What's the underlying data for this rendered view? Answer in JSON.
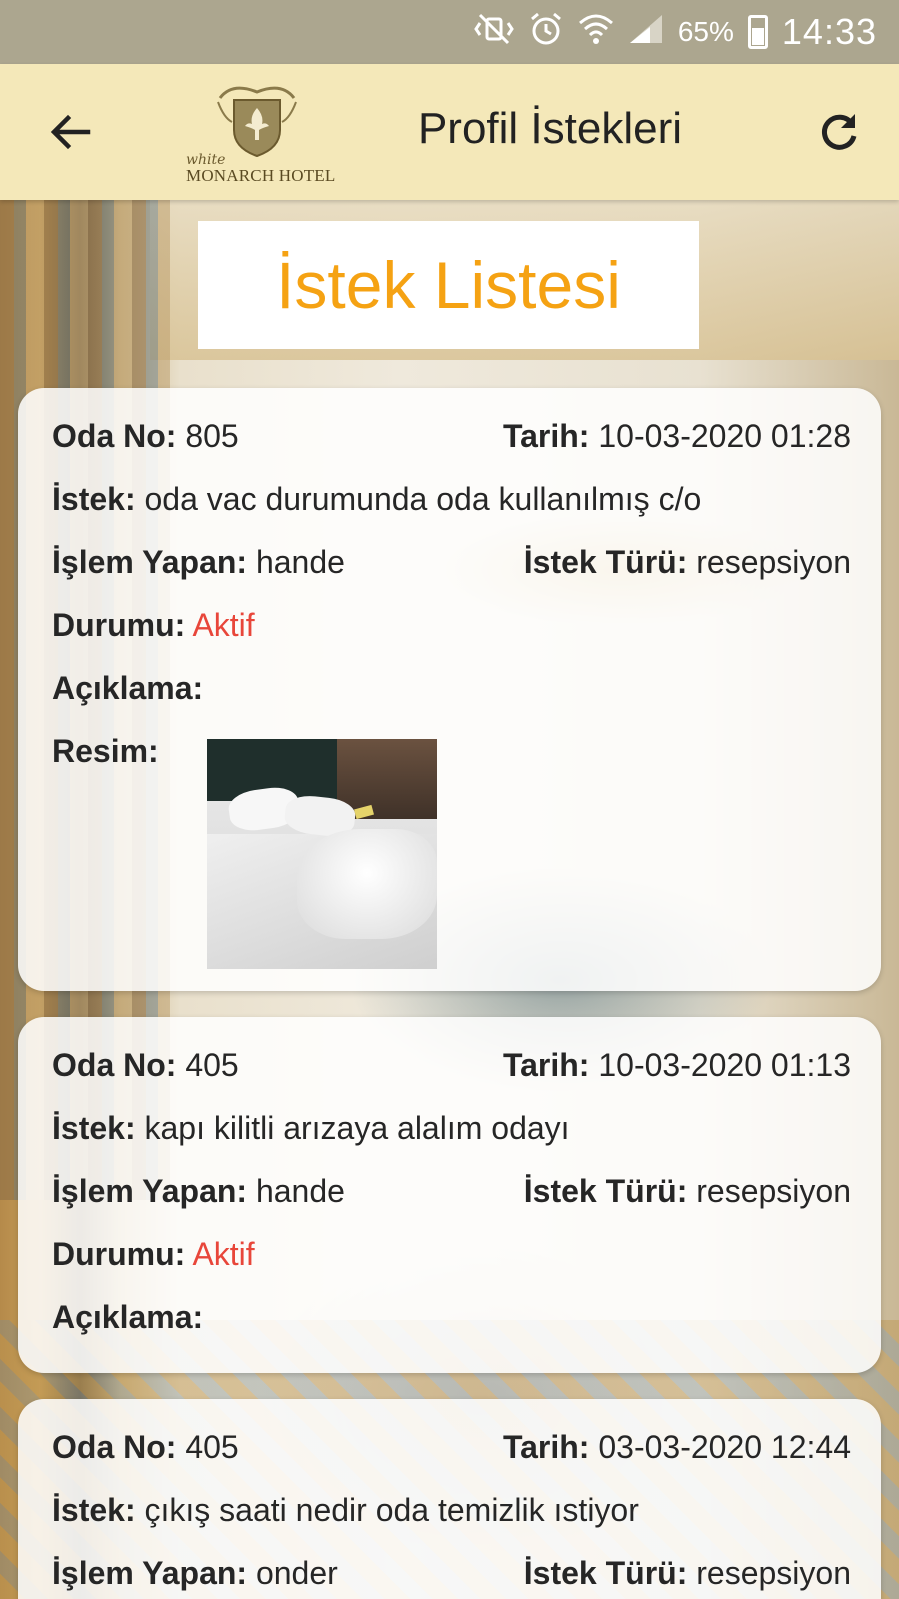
{
  "status_bar": {
    "icons": [
      "mute-vibrate-icon",
      "alarm-icon",
      "wifi-icon",
      "signal-icon",
      "battery-icon"
    ],
    "battery_pct": "65%",
    "time": "14:33"
  },
  "app_bar": {
    "back_icon": "arrow-back-icon",
    "logo": {
      "script": "white",
      "name": "MONARCH HOTEL"
    },
    "title": "Profil İstekleri",
    "refresh_icon": "refresh-icon"
  },
  "list_heading": "İstek Listesi",
  "labels": {
    "room": "Oda No:",
    "date": "Tarih:",
    "request": "İstek:",
    "handler": "İşlem Yapan:",
    "type": "İstek Türü:",
    "status": "Durumu:",
    "note": "Açıklama:",
    "image": "Resim:"
  },
  "requests": [
    {
      "room": "805",
      "date": "10-03-2020 01:28",
      "request": "oda vac durumunda oda kullanılmış c/o",
      "handler": "hande",
      "type": "resepsiyon",
      "status": "Aktif",
      "note": ""
    },
    {
      "room": "405",
      "date": "10-03-2020 01:13",
      "request": "kapı kilitli arızaya alalım odayı",
      "handler": "hande",
      "type": "resepsiyon",
      "status": "Aktif",
      "note": ""
    },
    {
      "room": "405",
      "date": "03-03-2020 12:44",
      "request": "çıkış saati nedir oda temizlik ıstiyor",
      "handler": "onder",
      "type": "resepsiyon"
    }
  ],
  "colors": {
    "status_bar": "#aca68f",
    "app_bar": "#f4e8b9",
    "heading_text": "#f5a213",
    "status_active": "#e8463a"
  }
}
